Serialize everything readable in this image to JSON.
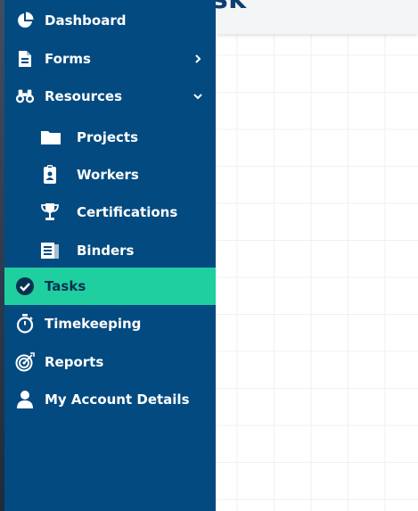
{
  "page": {
    "title_fragment": "Task"
  },
  "sidebar": {
    "items": [
      {
        "label": "Dashboard",
        "icon": "pie-chart-icon"
      },
      {
        "label": "Forms",
        "icon": "document-icon",
        "chevron": "chevron-right-icon"
      },
      {
        "label": "Resources",
        "icon": "binoculars-icon",
        "chevron": "chevron-down-icon"
      },
      {
        "label": "Projects",
        "icon": "folder-icon"
      },
      {
        "label": "Workers",
        "icon": "id-badge-icon"
      },
      {
        "label": "Certifications",
        "icon": "trophy-icon"
      },
      {
        "label": "Binders",
        "icon": "binder-icon"
      },
      {
        "label": "Tasks",
        "icon": "check-circle-icon",
        "active": true
      },
      {
        "label": "Timekeeping",
        "icon": "stopwatch-icon"
      },
      {
        "label": "Reports",
        "icon": "target-icon"
      },
      {
        "label": "My Account Details",
        "icon": "user-icon"
      }
    ]
  },
  "colors": {
    "sidebar_bg": "#034a80",
    "active_bg": "#20cfa0",
    "title": "#0e3e72"
  }
}
